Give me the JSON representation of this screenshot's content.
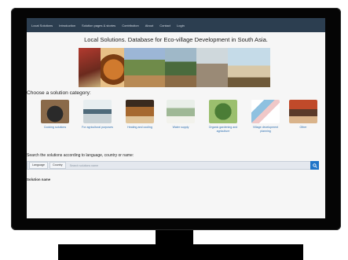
{
  "navbar": {
    "items": [
      "Local Solutions",
      "Introduction",
      "Solution pages & stories",
      "Contribution",
      "About",
      "Contact",
      "Login"
    ]
  },
  "page": {
    "title": "Local Solutions. Database for Eco-village Development in South Asia."
  },
  "categories": {
    "heading": "Choose a solution category:",
    "items": [
      {
        "label": "Cooking solutions",
        "icon": "cooking-photo"
      },
      {
        "label": "For agricultural purposes",
        "icon": "agriculture-photo"
      },
      {
        "label": "Heating and cooling",
        "icon": "heating-photo"
      },
      {
        "label": "Water supply",
        "icon": "water-photo"
      },
      {
        "label": "Organic gardening and agriculture",
        "icon": "organic-photo"
      },
      {
        "label": "Village development planning",
        "icon": "village-photo"
      },
      {
        "label": "Other",
        "icon": "other-photo"
      }
    ]
  },
  "search": {
    "heading": "Search the solutions according to language, country or name:",
    "language_label": "Language",
    "country_label": "Country",
    "placeholder": "Search solutions name",
    "button_icon": "search-icon"
  },
  "results": {
    "heading": "Solution name"
  },
  "colors": {
    "navbar": "#2c3e50",
    "link": "#2a6db0",
    "button": "#1f74c8",
    "bezel": "#050505"
  }
}
